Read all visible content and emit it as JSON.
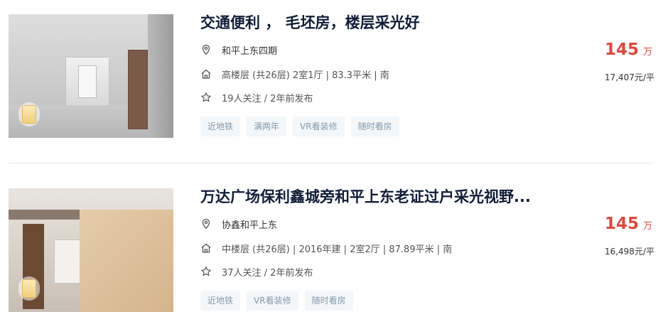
{
  "listings": [
    {
      "title": "交通便利 ， 毛坯房，楼层采光好",
      "community": "和平上东四期",
      "info": "高楼层 (共26层) 2室1厅 | 83.3平米 | 南",
      "follow": "19人关注 / 2年前发布",
      "tags": [
        "近地铁",
        "满两年",
        "VR看装修",
        "随时看房"
      ],
      "price": "145",
      "price_unit": "万",
      "unit_price": "17,407元/平"
    },
    {
      "title": "万达广场保利鑫城旁和平上东老证过户采光视野...",
      "community": "协鑫和平上东",
      "info": "中楼层 (共26层) | 2016年建 | 2室2厅 | 87.89平米 | 南",
      "follow": "37人关注 / 2年前发布",
      "tags": [
        "近地铁",
        "VR看装修",
        "随时看房"
      ],
      "price": "145",
      "price_unit": "万",
      "unit_price": "16,498元/平"
    }
  ],
  "icons": {
    "location": "location-pin-icon",
    "house": "house-icon",
    "star": "star-icon"
  },
  "colors": {
    "price": "#e1473d",
    "title": "#101d37",
    "tag_text": "#849aae",
    "tag_bg": "#f4f7f9"
  }
}
